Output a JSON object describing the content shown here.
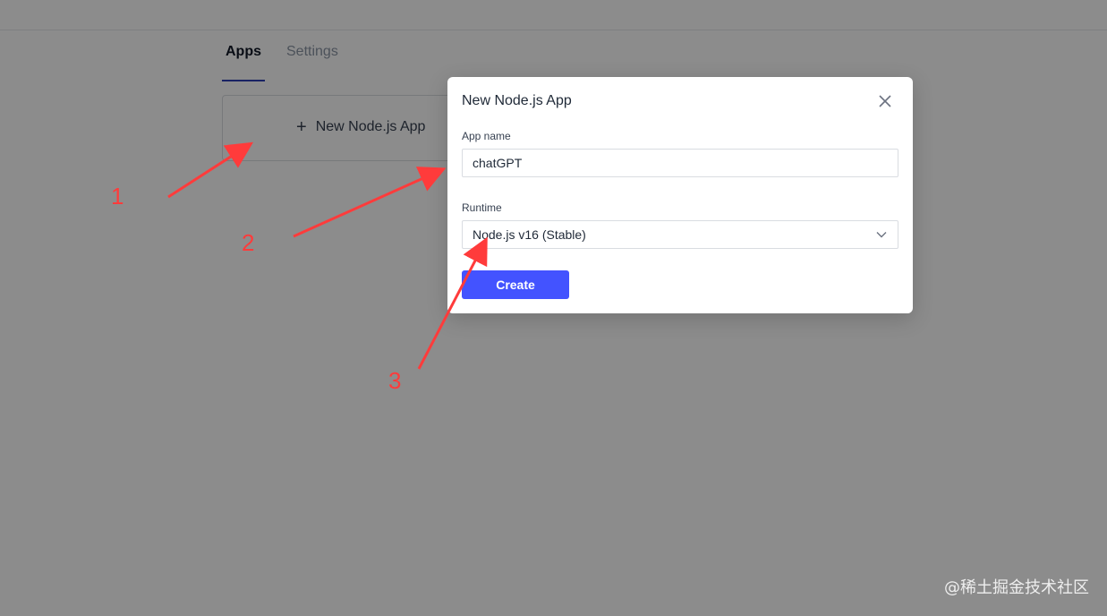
{
  "tabs": [
    {
      "label": "Apps",
      "active": true
    },
    {
      "label": "Settings",
      "active": false
    }
  ],
  "new_app_card": {
    "icon": "plus-icon",
    "label": "New Node.js App"
  },
  "modal": {
    "title": "New Node.js App",
    "close_icon": "close-icon",
    "app_name_label": "App name",
    "app_name_value": "chatGPT",
    "runtime_label": "Runtime",
    "runtime_value": "Node.js v16 (Stable)",
    "create_label": "Create"
  },
  "annotations": [
    "1",
    "2",
    "3"
  ],
  "watermark": "@稀土掘金技术社区",
  "colors": {
    "accent": "#4353ff",
    "tab_underline": "#2f3fb5",
    "annotation": "#ff3b3b",
    "overlay": "rgba(0,0,0,0.45)"
  }
}
